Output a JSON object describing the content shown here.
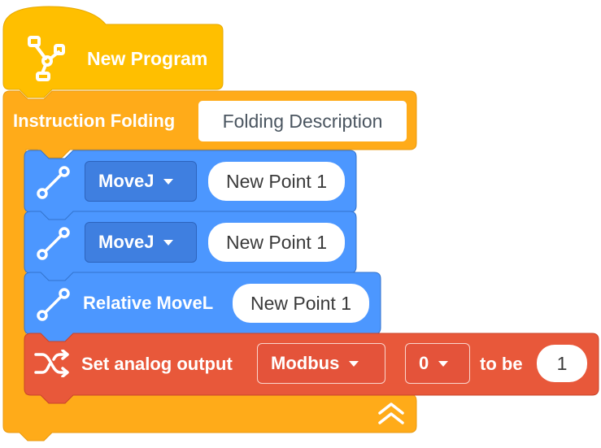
{
  "hat_block": {
    "title": "New Program",
    "icon": "robot-arm-icon",
    "color": "#FFBF00"
  },
  "fold_block": {
    "label": "Instruction Folding",
    "description_value": "Folding Description",
    "collapse_icon": "double-chevron-up-icon",
    "color": "#FFAB19"
  },
  "motion_blocks": [
    {
      "icon": "path-line-icon",
      "mode": "MoveJ",
      "point": "New Point 1",
      "color": "#4C97FF"
    },
    {
      "icon": "path-line-icon",
      "mode": "MoveJ",
      "point": "New Point 1",
      "color": "#4C97FF"
    },
    {
      "icon": "path-line-icon",
      "label": "Relative MoveL",
      "point": "New Point 1",
      "color": "#4C97FF"
    }
  ],
  "analog_block": {
    "icon": "shuffle-icon",
    "label": "Set analog output",
    "bus": "Modbus",
    "port": "0",
    "to_be_label": "to be",
    "value": "1",
    "color": "#E8583A"
  }
}
